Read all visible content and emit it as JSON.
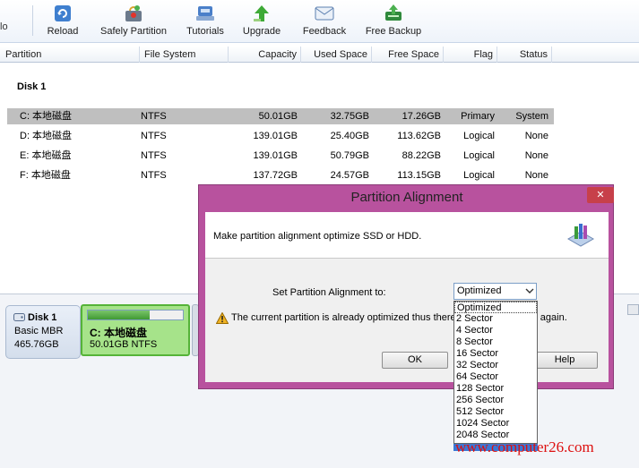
{
  "toolbar": {
    "cut_label": "lo",
    "buttons": [
      {
        "label": "Reload",
        "icon": "reload-icon"
      },
      {
        "label": "Safely Partition",
        "icon": "safe-partition-icon"
      },
      {
        "label": "Tutorials",
        "icon": "tutorials-icon"
      },
      {
        "label": "Upgrade",
        "icon": "upgrade-icon"
      },
      {
        "label": "Feedback",
        "icon": "feedback-icon"
      },
      {
        "label": "Free Backup",
        "icon": "backup-icon"
      }
    ]
  },
  "columns": [
    "Partition",
    "File System",
    "Capacity",
    "Used Space",
    "Free Space",
    "Flag",
    "Status"
  ],
  "disk_title": "Disk 1",
  "partitions": [
    {
      "partition": "C: 本地磁盘",
      "fs": "NTFS",
      "capacity": "50.01GB",
      "used": "32.75GB",
      "free": "17.26GB",
      "flag": "Primary",
      "status": "System",
      "selected": true
    },
    {
      "partition": "D: 本地磁盘",
      "fs": "NTFS",
      "capacity": "139.01GB",
      "used": "25.40GB",
      "free": "113.62GB",
      "flag": "Logical",
      "status": "None"
    },
    {
      "partition": "E: 本地磁盘",
      "fs": "NTFS",
      "capacity": "139.01GB",
      "used": "50.79GB",
      "free": "88.22GB",
      "flag": "Logical",
      "status": "None"
    },
    {
      "partition": "F: 本地磁盘",
      "fs": "NTFS",
      "capacity": "137.72GB",
      "used": "24.57GB",
      "free": "113.15GB",
      "flag": "Logical",
      "status": "None"
    }
  ],
  "disk_map": {
    "disk_name": "Disk 1",
    "disk_type": "Basic MBR",
    "disk_size": "465.76GB",
    "partition_name": "C: 本地磁盘",
    "partition_info": "50.01GB NTFS",
    "used_fraction": 0.65
  },
  "dialog": {
    "title": "Partition Alignment",
    "close": "✕",
    "description": "Make partition alignment optimize SSD or HDD.",
    "set_label": "Set Partition Alignment to:",
    "selected": "Optimized",
    "warning": "The current partition is already optimized thus there",
    "warning_tail": "t again.",
    "ok": "OK",
    "help": "Help",
    "options": [
      "Optimized",
      "2 Sector",
      "4 Sector",
      "8 Sector",
      "16 Sector",
      "32 Sector",
      "64 Sector",
      "128 Sector",
      "256 Sector",
      "512 Sector",
      "1024 Sector",
      "2048 Sector"
    ]
  },
  "watermark": "www.computer26.com",
  "colors": {
    "dialog_frame": "#b8529e",
    "selected_row": "#bfbfbf",
    "partition_block": "#a6e38a",
    "watermark": "#dd1010"
  }
}
